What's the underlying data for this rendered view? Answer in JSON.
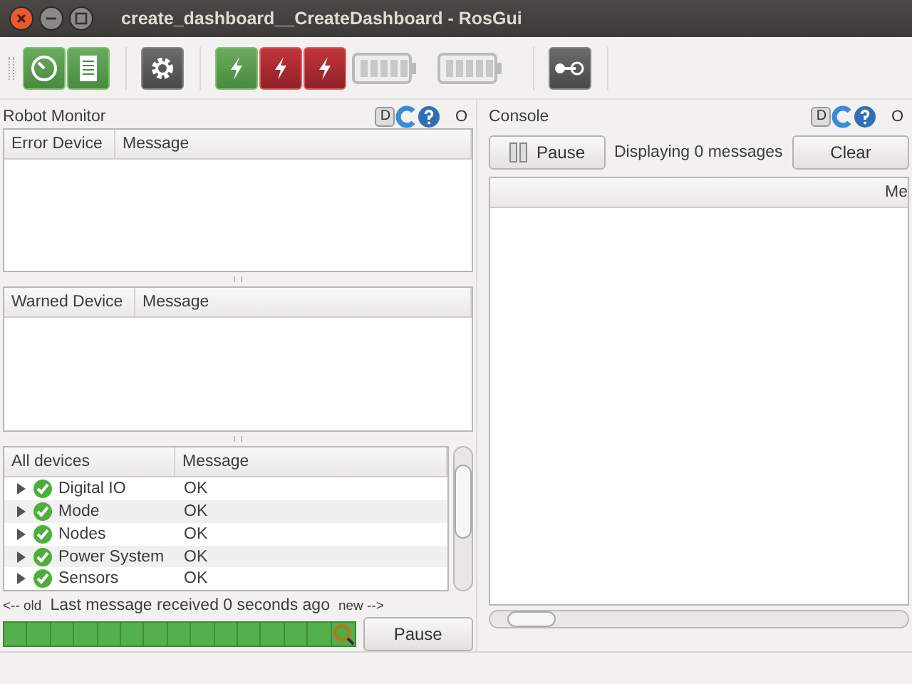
{
  "window": {
    "title": "create_dashboard__CreateDashboard - RosGui"
  },
  "toolbar": [
    {
      "kind": "gauge",
      "ok": true
    },
    {
      "kind": "notes",
      "ok": true
    },
    {
      "kind": "gear"
    },
    {
      "kind": "breaker",
      "ok": true
    },
    {
      "kind": "breaker",
      "ok": false
    },
    {
      "kind": "breaker",
      "ok": false
    },
    {
      "kind": "battery"
    },
    {
      "kind": "battery"
    },
    {
      "kind": "plug"
    }
  ],
  "robot_monitor": {
    "title": "Robot Monitor",
    "d_button": "D",
    "close": "O",
    "error_table": {
      "columns": [
        "Error Device",
        "Message"
      ]
    },
    "warn_table": {
      "columns": [
        "Warned Device",
        "Message"
      ]
    },
    "devices": {
      "columns": [
        "All devices",
        "Message"
      ],
      "rows": [
        {
          "name": "Digital IO",
          "message": "OK",
          "kind": "ok",
          "expanded": false
        },
        {
          "name": "Mode",
          "message": "OK",
          "kind": "ok",
          "expanded": false
        },
        {
          "name": "Nodes",
          "message": "OK",
          "kind": "ok",
          "expanded": false
        },
        {
          "name": "Power System",
          "message": "OK",
          "kind": "ok",
          "expanded": false
        },
        {
          "name": "Sensors",
          "message": "OK",
          "kind": "ok",
          "expanded": false
        }
      ]
    },
    "timeline": {
      "old": "<-- old",
      "status": "Last message received 0 seconds ago",
      "new": "new -->"
    },
    "pause_button": "Pause"
  },
  "console": {
    "title": "Console",
    "d_button": "D",
    "close": "O",
    "pause_button": "Pause",
    "count": "Displaying 0 messages",
    "clear_button": "Clear",
    "columns": [
      "Me"
    ]
  }
}
